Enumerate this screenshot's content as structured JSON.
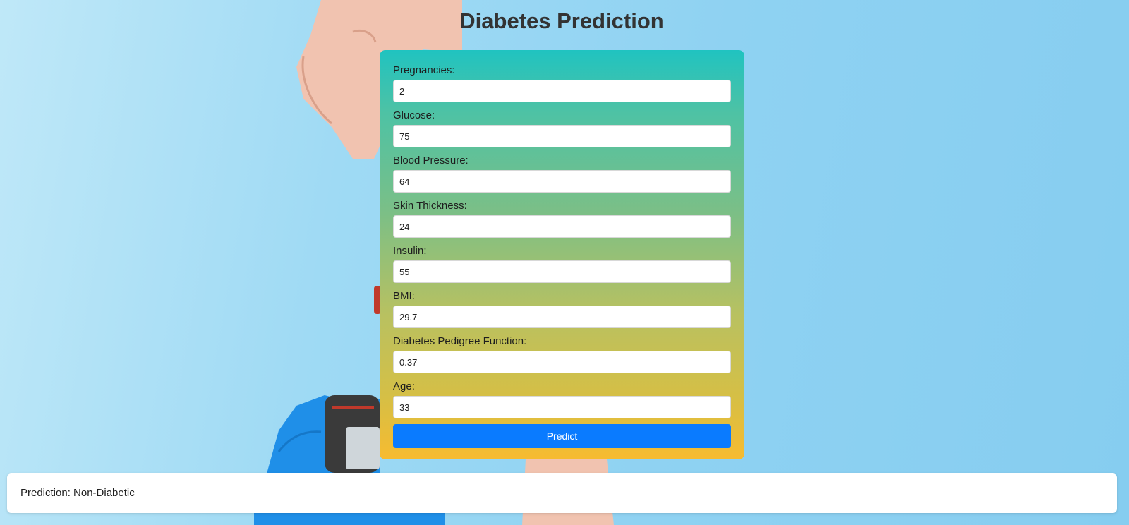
{
  "page": {
    "title": "Diabetes Prediction"
  },
  "form": {
    "fields": [
      {
        "label": "Pregnancies:",
        "value": "2"
      },
      {
        "label": "Glucose:",
        "value": "75"
      },
      {
        "label": "Blood Pressure:",
        "value": "64"
      },
      {
        "label": "Skin Thickness:",
        "value": "24"
      },
      {
        "label": "Insulin:",
        "value": "55"
      },
      {
        "label": "BMI:",
        "value": "29.7"
      },
      {
        "label": "Diabetes Pedigree Function:",
        "value": "0.37"
      },
      {
        "label": "Age:",
        "value": "33"
      }
    ],
    "submit_label": "Predict"
  },
  "result": {
    "text": "Prediction: Non-Diabetic"
  },
  "colors": {
    "accent": "#0a7bff",
    "card_top": "#20c3c0",
    "card_bottom": "#f7bb30",
    "background": "#8fd2f2"
  }
}
